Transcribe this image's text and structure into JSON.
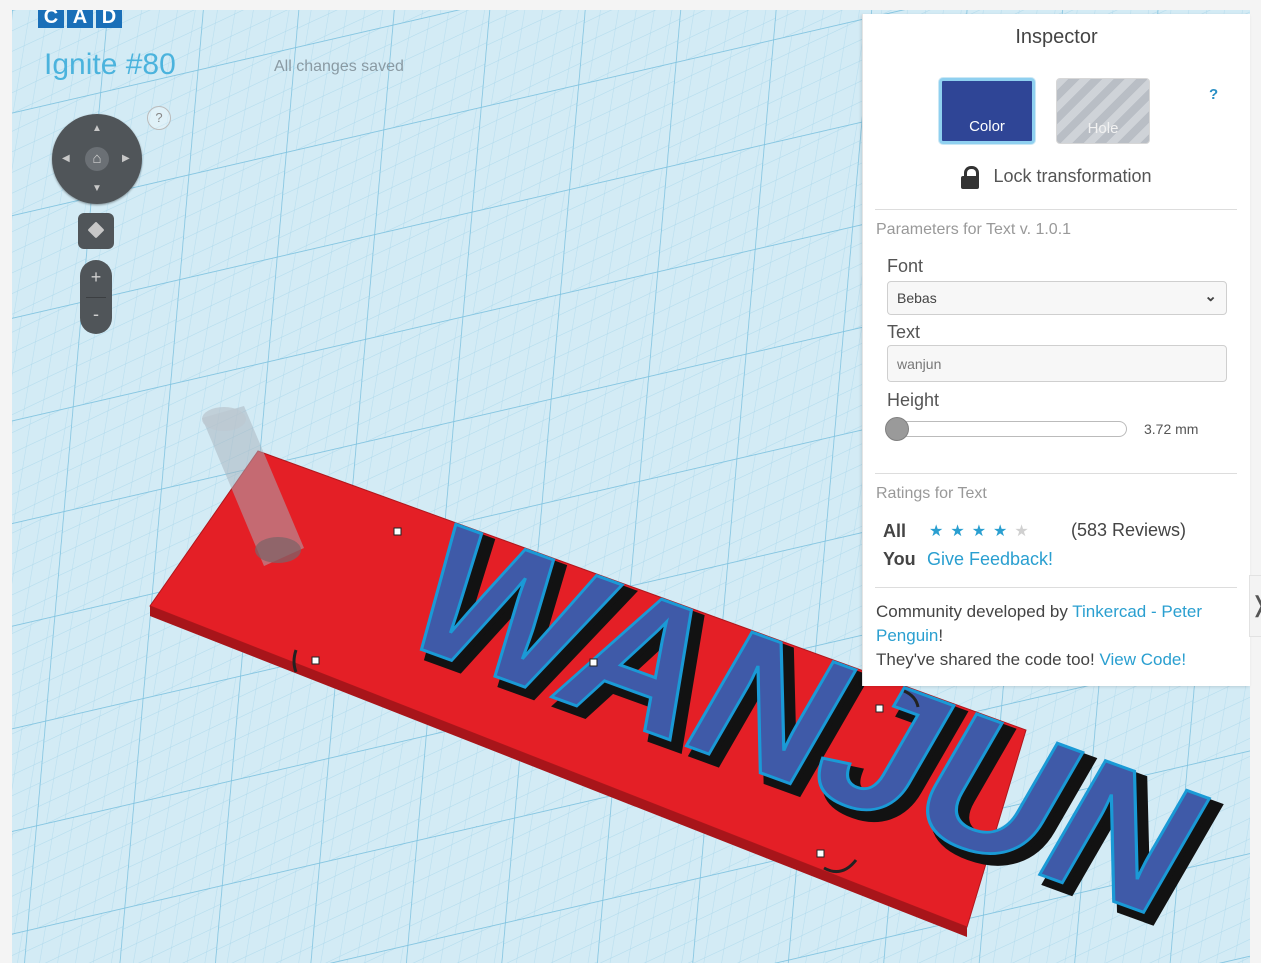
{
  "app": {
    "logo_letters": [
      "C",
      "A",
      "D"
    ],
    "project_title": "Ignite #80",
    "save_status": "All changes saved"
  },
  "nav": {
    "help": "?",
    "up_icon": "arrow-up-icon",
    "down_icon": "arrow-down-icon",
    "left_icon": "arrow-left-icon",
    "right_icon": "arrow-right-icon",
    "home_icon": "home-icon",
    "cube_icon": "view-cube-icon",
    "zoom_in": "+",
    "zoom_out": "-"
  },
  "scene": {
    "text": "WANJUN",
    "text_color": "#3f5aa8",
    "plate_color": "#e02027",
    "outline_color": "#1a9ad6",
    "cylinder_color": "#9aa7b4",
    "grid_bg": "#cfe8f3",
    "grid_line": "#8ccce6"
  },
  "inspector": {
    "title": "Inspector",
    "help": "?",
    "color_label": "Color",
    "color_value": "#2f4596",
    "hole_label": "Hole",
    "lock_label": "Lock transformation",
    "params_heading": "Parameters for Text v. 1.0.1",
    "font_label": "Font",
    "font_value": "Bebas",
    "text_label": "Text",
    "text_value": "wanjun",
    "height_label": "Height",
    "height_value": "3.72 mm",
    "height_fraction": 0.0,
    "ratings_heading": "Ratings for Text",
    "all_label": "All",
    "stars_filled": 4,
    "stars_total": 5,
    "reviews": "(583 Reviews)",
    "you_label": "You",
    "feedback_link": "Give Feedback!",
    "credit_prefix": "Community developed by ",
    "credit_link": "Tinkercad - Peter Penguin",
    "credit_suffix": "!",
    "shared_text": "They've shared the code too! ",
    "view_code_link": "View Code!"
  },
  "edge_toggle": "❭"
}
